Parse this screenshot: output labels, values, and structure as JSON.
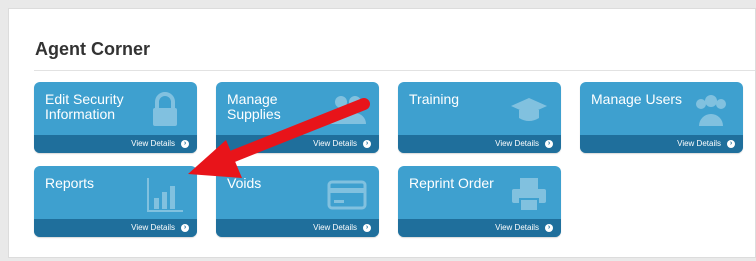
{
  "panel": {
    "title": "Agent Corner"
  },
  "tiles": [
    {
      "label": "Edit Security Information",
      "details": "View Details",
      "icon": "lock-icon"
    },
    {
      "label": "Manage Supplies",
      "details": "View Details",
      "icon": "people-icon"
    },
    {
      "label": "Training",
      "details": "View Details",
      "icon": "graduation-cap-icon"
    },
    {
      "label": "Manage Users",
      "details": "View Details",
      "icon": "users-icon"
    },
    {
      "label": "Reports",
      "details": "View Details",
      "icon": "bar-chart-icon"
    },
    {
      "label": "Voids",
      "details": "View Details",
      "icon": "credit-card-icon"
    },
    {
      "label": "Reprint Order",
      "details": "View Details",
      "icon": "printer-icon"
    }
  ],
  "colors": {
    "tile": "#3ea0cf",
    "tile_footer": "#1f6f9c",
    "annotation_arrow": "#e8141a"
  }
}
